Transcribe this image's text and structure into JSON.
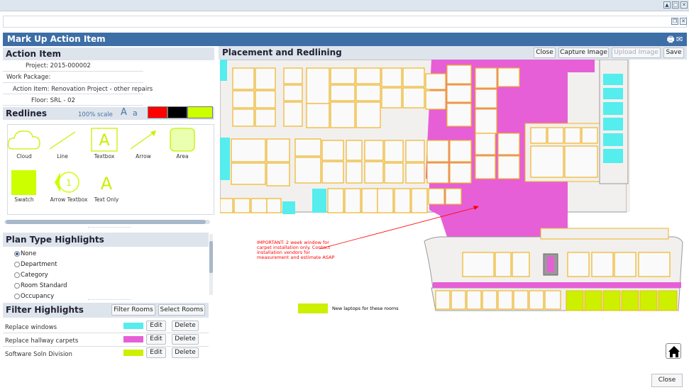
{
  "window": {
    "title": "Mark Up Action Item"
  },
  "action_item": {
    "heading": "Action Item",
    "project": "Project: 2015-000002",
    "work_package": "Work Package:",
    "action_item": "Action Item: Renovation Project - other repairs",
    "floor": "Floor: SRL - 02"
  },
  "redlines": {
    "heading": "Redlines",
    "scale": "100% scale",
    "font_large": "A",
    "font_small": "a",
    "colors": [
      "#ff0000",
      "#000000",
      "#ccff00"
    ],
    "tools": [
      {
        "label": "Cloud",
        "icon": "cloud-icon"
      },
      {
        "label": "Line",
        "icon": "line-icon"
      },
      {
        "label": "Textbox",
        "icon": "textbox-icon"
      },
      {
        "label": "Arrow",
        "icon": "arrow-icon"
      },
      {
        "label": "Area",
        "icon": "area-icon"
      },
      {
        "label": "Swatch",
        "icon": "swatch-icon"
      },
      {
        "label": "Arrow Textbox",
        "icon": "arrow-textbox-icon"
      },
      {
        "label": "Text Only",
        "icon": "text-only-icon"
      }
    ],
    "textbox_letter": "A",
    "arrow_textbox_number": "1",
    "text_only_letter": "A"
  },
  "plan_type": {
    "heading": "Plan Type Highlights",
    "options": [
      "None",
      "Department",
      "Category",
      "Room Standard",
      "Occupancy"
    ],
    "selected": "None"
  },
  "filter": {
    "heading": "Filter Highlights",
    "filter_rooms": "Filter Rooms",
    "select_rooms": "Select Rooms",
    "rows": [
      {
        "label": "Replace windows",
        "color": "#55eded",
        "edit": "Edit",
        "delete": "Delete"
      },
      {
        "label": "Replace hallway carpets",
        "color": "#e65fd6",
        "edit": "Edit",
        "delete": "Delete"
      },
      {
        "label": "Software Soln Division",
        "color": "#ccf000",
        "edit": "Edit",
        "delete": "Delete"
      }
    ]
  },
  "placement": {
    "heading": "Placement and Redlining",
    "close": "Close",
    "capture": "Capture Image",
    "upload": "Upload Image",
    "save": "Save"
  },
  "plan": {
    "annotation": "IMPORTANT: 2 week window for carpet installation only. Contact installation vendors for measurement and estimate ASAP",
    "annotation_lines": [
      "IMPORTANT: 2 week window for",
      "carpet installation only. Contact",
      "installation vendors for",
      "measurement and estimate ASAP"
    ],
    "legend_label": "New laptops for these rooms",
    "colors": {
      "carpet": "#e65fd6",
      "windows": "#55eded",
      "laptops": "#ccf000",
      "walls": "#f0b323",
      "room": "#f2f0ee",
      "red": "#ff0000"
    }
  },
  "footer": {
    "close": "Close"
  }
}
